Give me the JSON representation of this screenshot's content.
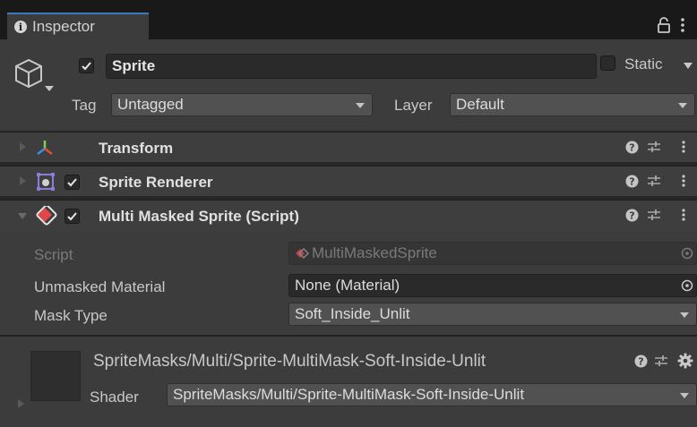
{
  "window": {
    "tab_title": "Inspector"
  },
  "gameobject": {
    "name": "Sprite",
    "active": true,
    "static_label": "Static",
    "static_checked": false,
    "tag_label": "Tag",
    "tag_value": "Untagged",
    "layer_label": "Layer",
    "layer_value": "Default"
  },
  "components": [
    {
      "title": "Transform",
      "expanded": false,
      "has_checkbox": false
    },
    {
      "title": "Sprite Renderer",
      "expanded": false,
      "has_checkbox": true,
      "checked": true
    },
    {
      "title": "Multi Masked Sprite (Script)",
      "expanded": true,
      "has_checkbox": true,
      "checked": true
    }
  ],
  "script_props": {
    "script_label": "Script",
    "script_value": "MultiMaskedSprite",
    "unmasked_label": "Unmasked Material",
    "unmasked_value": "None (Material)",
    "masktype_label": "Mask Type",
    "masktype_value": "Soft_Inside_Unlit"
  },
  "material": {
    "name": "SpriteMasks/Multi/Sprite-MultiMask-Soft-Inside-Unlit",
    "shader_label": "Shader",
    "shader_value": "SpriteMasks/Multi/Sprite-MultiMask-Soft-Inside-Unlit"
  },
  "colors": {
    "accent": "#3a79bb",
    "panel": "#3c3c3c",
    "field": "#2a2a2a",
    "dropdown": "#515151"
  }
}
